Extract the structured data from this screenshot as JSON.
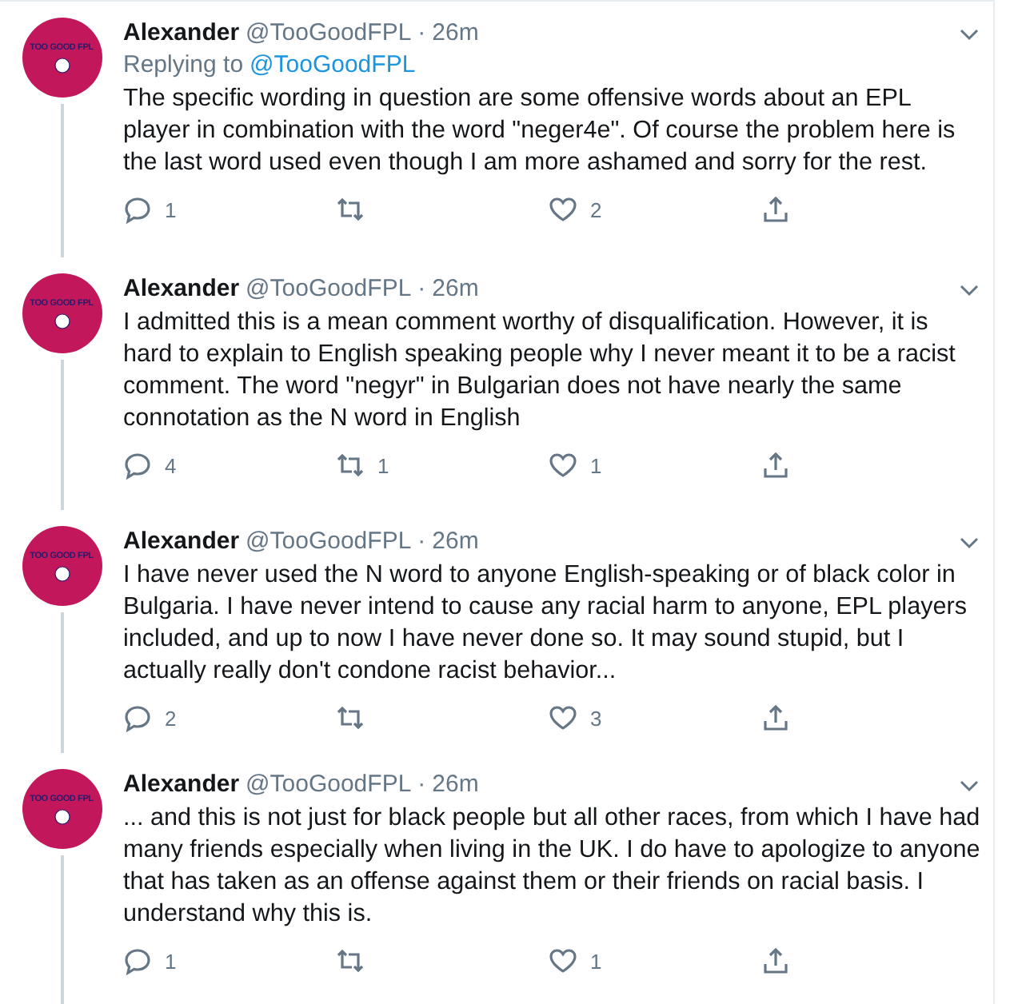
{
  "tweets": [
    {
      "avatar_label": "TOO GOOD FPL",
      "name": "Alexander",
      "handle": "@TooGoodFPL",
      "time": "26m",
      "separator": "·",
      "replying_prefix": "Replying to",
      "replying_to": "@TooGoodFPL",
      "text": "The specific wording in question are some offensive words about an EPL player in combination with the word \"neger4e\".  Of course the problem here is the last word used even though I am more ashamed and sorry for the rest.",
      "replies": "1",
      "likes": "2"
    },
    {
      "avatar_label": "TOO GOOD FPL",
      "name": "Alexander",
      "handle": "@TooGoodFPL",
      "time": "26m",
      "separator": "·",
      "text": "I admitted this is a mean comment worthy of disqualification. However, it is hard to explain to English speaking people why I never meant it to be a racist comment. The word \"negyr\" in Bulgarian does not have nearly the same connotation as the N word in English",
      "replies": "4",
      "retweets": "1",
      "likes": "1"
    },
    {
      "avatar_label": "TOO GOOD FPL",
      "name": "Alexander",
      "handle": "@TooGoodFPL",
      "time": "26m",
      "separator": "·",
      "text": "I have never used the N word to anyone English-speaking or of black color in Bulgaria. I have never intend to cause any racial harm to anyone, EPL players included, and up to now I have never done so. It may sound stupid, but I actually really don't condone racist behavior...",
      "replies": "2",
      "likes": "3"
    },
    {
      "avatar_label": "TOO GOOD FPL",
      "name": "Alexander",
      "handle": "@TooGoodFPL",
      "time": "26m",
      "separator": "·",
      "text": "... and this is not just for black people but all other races, from which I have had many friends especially when living in the UK. I do have to apologize to anyone that has taken as an offense against them or their friends on racial basis. I understand why this is.",
      "replies": "1",
      "likes": "1"
    }
  ]
}
